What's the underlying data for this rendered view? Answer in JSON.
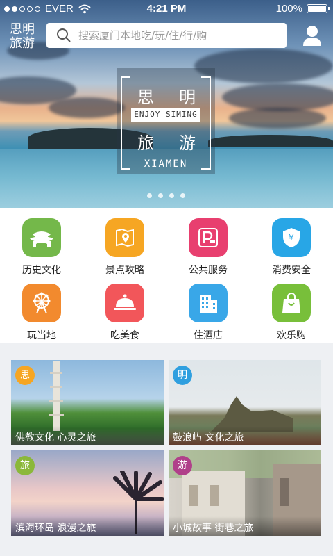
{
  "status": {
    "carrier": "EVER",
    "time": "4:21 PM",
    "battery": "100%",
    "battery_level": 1.0
  },
  "header": {
    "brand_line1": "思明",
    "brand_line2": "旅游",
    "search_placeholder": "搜索厦门本地吃/玩/住/行/购"
  },
  "hero": {
    "title_top_left": "思",
    "title_top_right": "明",
    "enjoy": "ENJOY SIMING",
    "title_bottom_left": "旅",
    "title_bottom_right": "游",
    "city": "XIAMEN",
    "pages": 4
  },
  "categories": [
    {
      "label": "历史文化",
      "icon": "gate-icon",
      "color": "#74b84a"
    },
    {
      "label": "景点攻略",
      "icon": "map-pin-icon",
      "color": "#f6a623"
    },
    {
      "label": "公共服务",
      "icon": "parking-icon",
      "color": "#e83f6f"
    },
    {
      "label": "消费安全",
      "icon": "shield-yen-icon",
      "color": "#28a6e6"
    },
    {
      "label": "玩当地",
      "icon": "ferris-wheel-icon",
      "color": "#f28a2e"
    },
    {
      "label": "吃美食",
      "icon": "cloche-icon",
      "color": "#f2565a"
    },
    {
      "label": "住酒店",
      "icon": "building-icon",
      "color": "#39a7e8"
    },
    {
      "label": "欢乐购",
      "icon": "shopping-bag-icon",
      "color": "#78bf3a"
    }
  ],
  "cards": [
    {
      "badge": "思",
      "badge_color": "#f6a623",
      "caption": "佛教文化 心灵之旅"
    },
    {
      "badge": "明",
      "badge_color": "#2f9fdf",
      "caption": "鼓浪屿 文化之旅"
    },
    {
      "badge": "旅",
      "badge_color": "#8bb83a",
      "caption": "滨海环岛 浪漫之旅"
    },
    {
      "badge": "游",
      "badge_color": "#b0408a",
      "caption": "小城故事 街巷之旅"
    }
  ]
}
